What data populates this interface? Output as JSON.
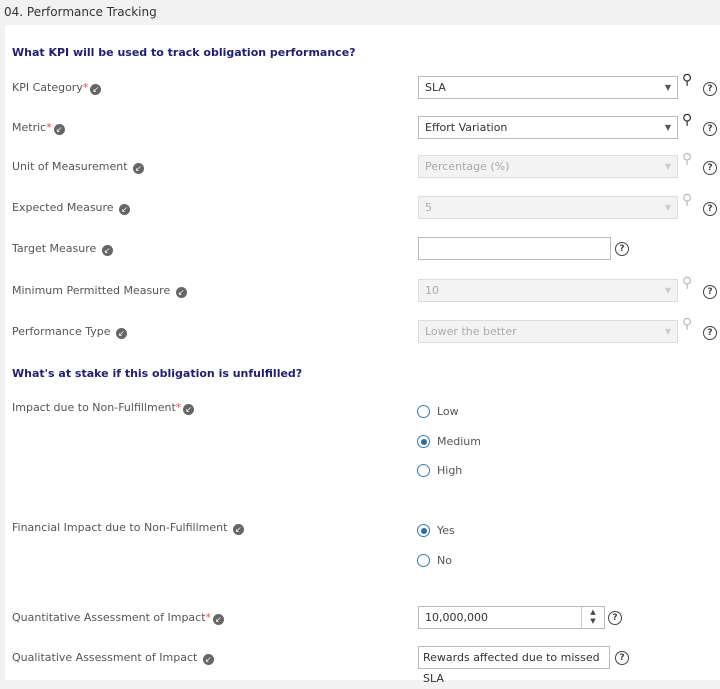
{
  "header": {
    "title": "04. Performance Tracking"
  },
  "section1": {
    "title": "What KPI will be used to track obligation performance?"
  },
  "fields": [
    {
      "label": "KPI Category",
      "required": true,
      "value": "SLA",
      "disabled": false
    },
    {
      "label": "Metric",
      "required": true,
      "value": "Effort Variation",
      "disabled": false
    },
    {
      "label": "Unit of Measurement",
      "required": false,
      "value": "Percentage (%)",
      "disabled": true
    },
    {
      "label": "Expected Measure",
      "required": false,
      "value": "5",
      "disabled": true
    },
    {
      "label": "Target Measure",
      "required": false,
      "value": "",
      "disabled": false
    },
    {
      "label": "Minimum Permitted Measure",
      "required": false,
      "value": "10",
      "disabled": true
    },
    {
      "label": "Performance Type",
      "required": false,
      "value": "Lower the better",
      "disabled": true
    }
  ],
  "section2": {
    "title": "What's at stake if this obligation is unfulfilled?"
  },
  "impact": {
    "label": "Impact due to Non-Fulfillment",
    "options": [
      "Low",
      "Medium",
      "High"
    ],
    "selected": "Medium"
  },
  "financial": {
    "label": "Financial Impact due to Non-Fulfillment",
    "options": [
      "Yes",
      "No"
    ],
    "selected": "Yes"
  },
  "quantitative": {
    "label": "Quantitative Assessment of Impact",
    "value": "10,000,000"
  },
  "qualitative": {
    "label": "Qualitative Assessment of Impact",
    "value": "Rewards affected due to missed SLA"
  },
  "symbols": {
    "required": "*",
    "info": "↙",
    "caret": "▼",
    "help": "?",
    "lookup": "⚲",
    "spin_up": "▲",
    "spin_down": "▼"
  },
  "colors": {
    "section_title": "#1f1f6e",
    "radio": "#2e6da4",
    "required": "#d9534f"
  }
}
